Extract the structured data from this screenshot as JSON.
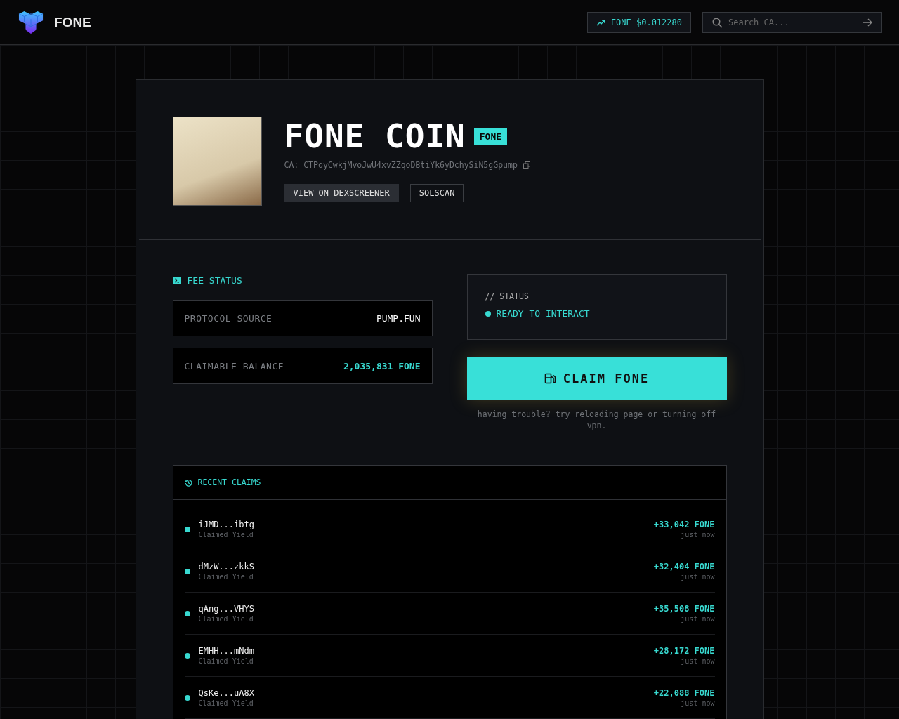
{
  "header": {
    "brand": "FONE",
    "price": "FONE $0.012280",
    "search": {
      "placeholder": "Search CA..."
    }
  },
  "token": {
    "name": "FONE COIN",
    "ticker": "FONE",
    "ca": "CA: CTPoyCwkjMvoJwU4xvZZqoD8tiYk6yDchySiN5gGpump",
    "buttons": [
      {
        "label": "VIEW ON DEXSCREENER",
        "kind": "filled"
      },
      {
        "label": "SOLSCAN",
        "kind": "outline"
      }
    ]
  },
  "fee_status": {
    "title": "FEE STATUS",
    "rows": [
      {
        "label": "PROTOCOL SOURCE",
        "value": "PUMP.FUN",
        "highlight": false
      },
      {
        "label": "CLAIMABLE BALANCE",
        "value": "2,035,831 FONE",
        "highlight": true
      }
    ]
  },
  "status": {
    "title": "// STATUS",
    "message": "READY TO INTERACT"
  },
  "claim": {
    "label": "CLAIM FONE",
    "hint": "having trouble? try reloading page or turning off vpn."
  },
  "recent_claims": {
    "title": "RECENT CLAIMS",
    "items": [
      {
        "wallet": "iJMD...ibtg",
        "action": "Claimed Yield",
        "amount": "+33,042 FONE",
        "time": "just now"
      },
      {
        "wallet": "dMzW...zkkS",
        "action": "Claimed Yield",
        "amount": "+32,404 FONE",
        "time": "just now"
      },
      {
        "wallet": "qAng...VHYS",
        "action": "Claimed Yield",
        "amount": "+35,508 FONE",
        "time": "just now"
      },
      {
        "wallet": "EMHH...mNdm",
        "action": "Claimed Yield",
        "amount": "+28,172 FONE",
        "time": "just now"
      },
      {
        "wallet": "QsKe...uA8X",
        "action": "Claimed Yield",
        "amount": "+22,088 FONE",
        "time": "just now"
      }
    ]
  }
}
